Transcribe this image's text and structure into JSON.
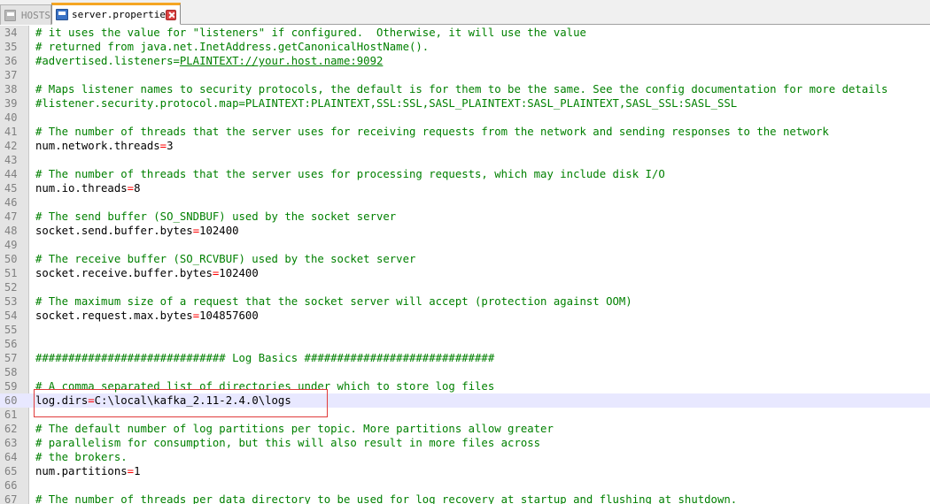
{
  "tabs": [
    {
      "label": "HOSTS",
      "active": false
    },
    {
      "label": "server.properties",
      "active": true
    }
  ],
  "colors": {
    "comment": "#008000",
    "operator": "#ff0000",
    "current_line": "#e8e8ff",
    "highlight_box": "#e03c3c",
    "tab_accent": "#f5a623"
  },
  "lines": [
    {
      "n": "34",
      "type": "comment",
      "text": "# it uses the value for \"listeners\" if configured.  Otherwise, it will use the value"
    },
    {
      "n": "35",
      "type": "comment",
      "text": "# returned from java.net.InetAddress.getCanonicalHostName()."
    },
    {
      "n": "36",
      "type": "commented-setting",
      "pre": "#advertised.listeners=",
      "link": "PLAINTEXT://your.host.name:9092"
    },
    {
      "n": "37",
      "type": "empty"
    },
    {
      "n": "38",
      "type": "comment",
      "text": "# Maps listener names to security protocols, the default is for them to be the same. See the config documentation for more details"
    },
    {
      "n": "39",
      "type": "comment",
      "text": "#listener.security.protocol.map=PLAINTEXT:PLAINTEXT,SSL:SSL,SASL_PLAINTEXT:SASL_PLAINTEXT,SASL_SSL:SASL_SSL"
    },
    {
      "n": "40",
      "type": "empty"
    },
    {
      "n": "41",
      "type": "comment",
      "text": "# The number of threads that the server uses for receiving requests from the network and sending responses to the network"
    },
    {
      "n": "42",
      "type": "setting",
      "key": "num.network.threads",
      "value": "3"
    },
    {
      "n": "43",
      "type": "empty"
    },
    {
      "n": "44",
      "type": "comment",
      "text": "# The number of threads that the server uses for processing requests, which may include disk I/O"
    },
    {
      "n": "45",
      "type": "setting",
      "key": "num.io.threads",
      "value": "8"
    },
    {
      "n": "46",
      "type": "empty"
    },
    {
      "n": "47",
      "type": "comment",
      "text": "# The send buffer (SO_SNDBUF) used by the socket server"
    },
    {
      "n": "48",
      "type": "setting",
      "key": "socket.send.buffer.bytes",
      "value": "102400"
    },
    {
      "n": "49",
      "type": "empty"
    },
    {
      "n": "50",
      "type": "comment",
      "text": "# The receive buffer (SO_RCVBUF) used by the socket server"
    },
    {
      "n": "51",
      "type": "setting",
      "key": "socket.receive.buffer.bytes",
      "value": "102400"
    },
    {
      "n": "52",
      "type": "empty"
    },
    {
      "n": "53",
      "type": "comment",
      "text": "# The maximum size of a request that the socket server will accept (protection against OOM)"
    },
    {
      "n": "54",
      "type": "setting",
      "key": "socket.request.max.bytes",
      "value": "104857600"
    },
    {
      "n": "55",
      "type": "empty"
    },
    {
      "n": "56",
      "type": "empty"
    },
    {
      "n": "57",
      "type": "comment",
      "text": "############################# Log Basics #############################"
    },
    {
      "n": "58",
      "type": "empty"
    },
    {
      "n": "59",
      "type": "comment",
      "text": "# A comma separated list of directories under which to store log files"
    },
    {
      "n": "60",
      "type": "setting",
      "key": "log.dirs",
      "value": "C:\\local\\kafka_2.11-2.4.0\\logs",
      "current": true
    },
    {
      "n": "61",
      "type": "empty"
    },
    {
      "n": "62",
      "type": "comment",
      "text": "# The default number of log partitions per topic. More partitions allow greater"
    },
    {
      "n": "63",
      "type": "comment",
      "text": "# parallelism for consumption, but this will also result in more files across"
    },
    {
      "n": "64",
      "type": "comment",
      "text": "# the brokers."
    },
    {
      "n": "65",
      "type": "setting",
      "key": "num.partitions",
      "value": "1"
    },
    {
      "n": "66",
      "type": "empty"
    },
    {
      "n": "67",
      "type": "comment",
      "text": "# The number of threads per data directory to be used for log recovery at startup and flushing at shutdown."
    }
  ]
}
